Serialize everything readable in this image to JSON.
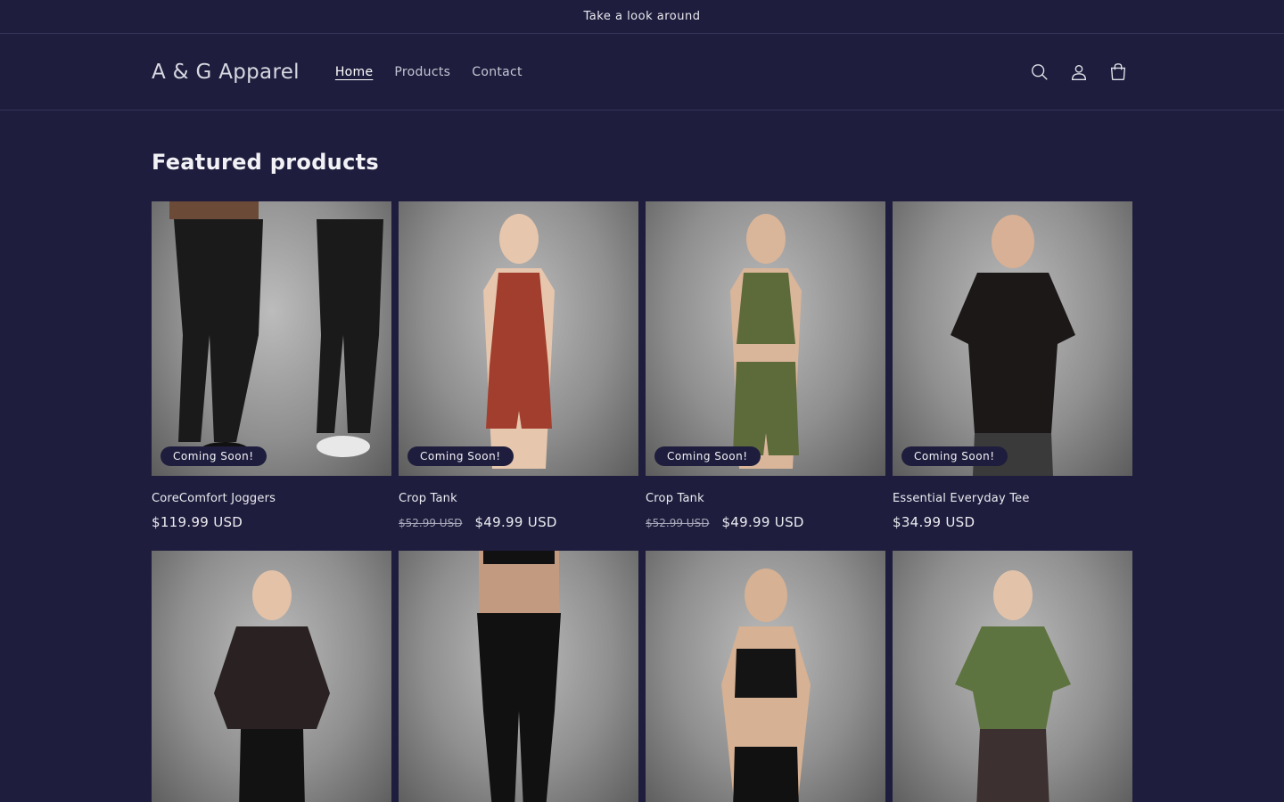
{
  "announcement": {
    "text": "Take a look around"
  },
  "header": {
    "logo": "A & G Apparel",
    "nav": [
      {
        "label": "Home",
        "active": true
      },
      {
        "label": "Products",
        "active": false
      },
      {
        "label": "Contact",
        "active": false
      }
    ],
    "icons": [
      "search-icon",
      "account-icon",
      "cart-icon"
    ]
  },
  "featured": {
    "title": "Featured products",
    "products": [
      {
        "title": "CoreComfort Joggers",
        "badge": "Coming Soon!",
        "compare_price": "",
        "price": "$119.99 USD",
        "garment_color": "#1a1a1a"
      },
      {
        "title": "Crop Tank",
        "badge": "Coming Soon!",
        "compare_price": "$52.99 USD",
        "price": "$49.99 USD",
        "garment_color": "#a23e2e"
      },
      {
        "title": "Crop Tank",
        "badge": "Coming Soon!",
        "compare_price": "$52.99 USD",
        "price": "$49.99 USD",
        "garment_color": "#5d6a3a"
      },
      {
        "title": "Essential Everyday Tee",
        "badge": "Coming Soon!",
        "compare_price": "",
        "price": "$34.99 USD",
        "garment_color": "#1c1818"
      }
    ],
    "products_row2": [
      {
        "garment_color": "#2a2222"
      },
      {
        "garment_color": "#111111"
      },
      {
        "garment_color": "#141414"
      },
      {
        "garment_color": "#5e7440"
      }
    ]
  },
  "colors": {
    "background": "#1e1d3d",
    "accent": "#ffffff"
  }
}
